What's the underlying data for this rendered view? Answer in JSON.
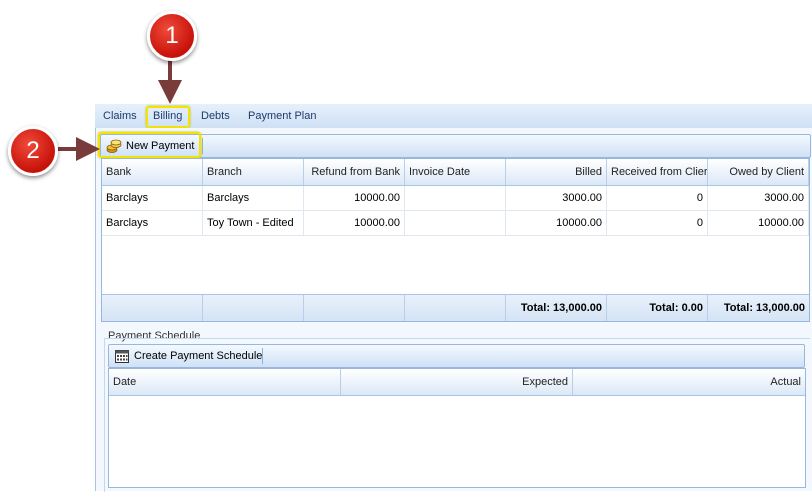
{
  "tabs": [
    "Claims",
    "Billing",
    "Debts",
    "Payment Plan"
  ],
  "toolbar": {
    "new_payment": "New Payment"
  },
  "billing_grid": {
    "headers": [
      "Bank",
      "Branch",
      "Refund from Bank",
      "Invoice Date",
      "Billed",
      "Received from Clier",
      "Owed by Client"
    ],
    "rows": [
      [
        "Barclays",
        "Barclays",
        "10000.00",
        "",
        "3000.00",
        "0",
        "3000.00"
      ],
      [
        "Barclays",
        "Toy Town - Edited",
        "10000.00",
        "",
        "10000.00",
        "0",
        "10000.00"
      ]
    ],
    "totals": {
      "billed": "Total: 13,000.00",
      "received": "Total: 0.00",
      "owed": "Total: 13,000.00"
    }
  },
  "schedule": {
    "section_title": "Payment Schedule",
    "create_button": "Create Payment Schedule",
    "headers": [
      "Date",
      "Expected",
      "Actual"
    ]
  },
  "callouts": [
    "1",
    "2"
  ],
  "colors": {
    "callout": "#d21a10",
    "highlight": "#f2e400",
    "arrow": "#7a3b3b"
  }
}
